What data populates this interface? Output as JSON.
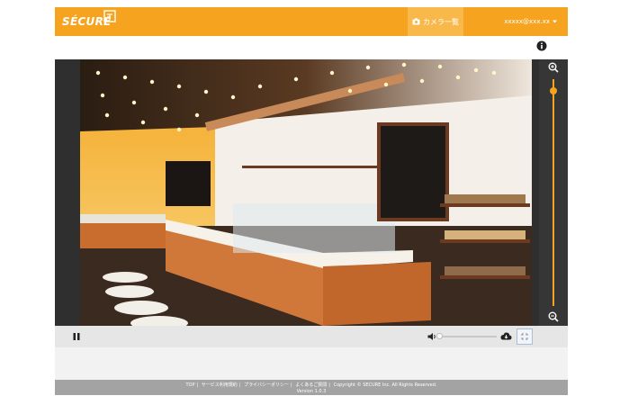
{
  "header": {
    "logo_text": "SÉCURE",
    "nav_camera_label": "カメラ一覧",
    "user_email": "xxxxx@xxx.xx"
  },
  "viewer": {
    "zoom_level": 0.95
  },
  "controls": {
    "volume_level": 0.0
  },
  "footer": {
    "links": [
      "TOP",
      "サービス利用規約",
      "プライバシーポリシー",
      "よくあるご質問"
    ],
    "copyright": "Copyright © SECURE Inc. All Rights Reserved.",
    "version": "Version 1.0.3"
  },
  "colors": {
    "brand_orange": "#f6a420",
    "viewer_bg": "#2f2f2f",
    "footer_bg": "#a3a3a3"
  },
  "icons": [
    "camera-icon",
    "chevron-down-icon",
    "info-icon",
    "zoom-in-icon",
    "zoom-out-icon",
    "pause-icon",
    "volume-icon",
    "snapshot-icon",
    "fit-screen-icon"
  ]
}
